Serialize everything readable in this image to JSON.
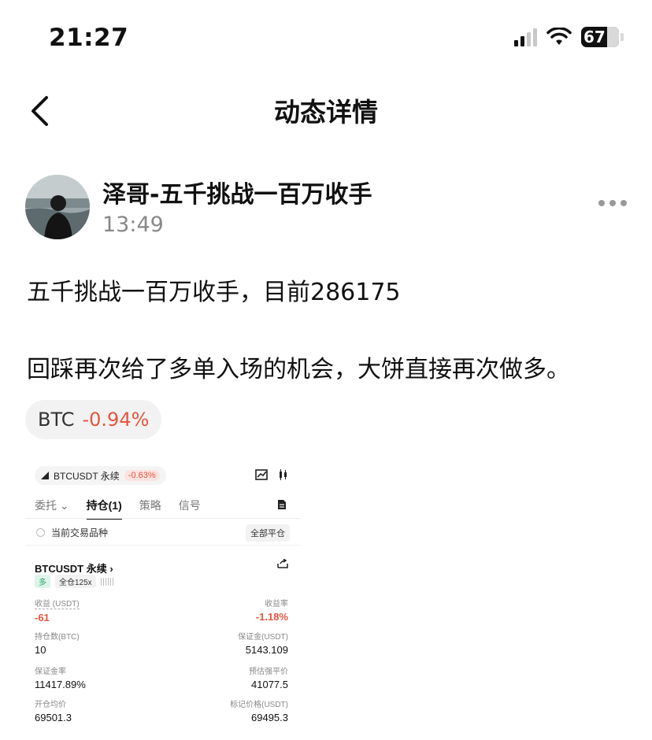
{
  "status_bar": {
    "time": "21:27",
    "battery": "67",
    "icons": [
      "signal-icon",
      "wifi-icon",
      "battery-icon"
    ]
  },
  "nav": {
    "back_icon": "chevron-left-icon",
    "title": "动态详情"
  },
  "post": {
    "author": "泽哥-五千挑战一百万收手",
    "time": "13:49",
    "more_icon": "more-dots-icon",
    "lines": [
      "五千挑战一百万收手，目前286175",
      "回踩再次给了多单入场的机会，大饼直接再次做多。"
    ],
    "ticker": {
      "symbol": "BTC",
      "change": "-0.94%"
    }
  },
  "screenshot": {
    "pair": "BTCUSDT 永续",
    "pair_change": "-0.63%",
    "tabs": [
      {
        "label": "委托",
        "active": false
      },
      {
        "label": "持仓(1)",
        "active": true
      },
      {
        "label": "策略",
        "active": false
      },
      {
        "label": "信号",
        "active": false
      }
    ],
    "filter_label": "当前交易品种",
    "close_all_label": "全部平仓",
    "position": {
      "title": "BTCUSDT 永续",
      "side_tag": "多",
      "margin_tag": "全仓125x",
      "fields": {
        "pnl_label": "收益 (USDT)",
        "pnl_value": "-61",
        "roe_label": "收益率",
        "roe_value": "-1.18%",
        "size_label": "持仓数(BTC)",
        "size_value": "10",
        "margin_label": "保证金(USDT)",
        "margin_value": "5143.109",
        "margin_rate_label": "保证金率",
        "margin_rate_value": "11417.89%",
        "liq_label": "预估强平价",
        "liq_value": "41077.5",
        "entry_label": "开仓均价",
        "entry_value": "69501.3",
        "mark_label": "标记价格(USDT)",
        "mark_value": "69495.3"
      }
    },
    "colors": {
      "negative": "#e5553f",
      "long": "#2aa56a"
    }
  }
}
